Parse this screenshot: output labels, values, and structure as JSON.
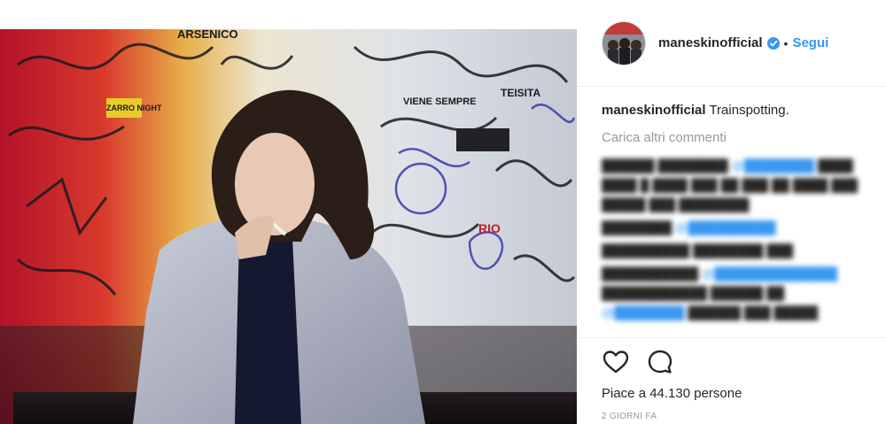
{
  "post": {
    "username": "maneskinofficial",
    "follow_label": "Segui",
    "separator": "•",
    "caption_text": "Trainspotting.",
    "load_more": "Carica altri commenti",
    "likes": "Piace a 44.130 persone",
    "time": "2 GIORNI FA"
  },
  "photo": {
    "labels": [
      "ARSENICO",
      "ZARRO NIGHT",
      "RIO",
      "VIENE SEMPRE",
      "TEISITA"
    ]
  },
  "icons": {
    "verified": "verified-badge-icon",
    "like": "heart-icon",
    "comment": "comment-icon"
  },
  "colors": {
    "link": "#3897f0",
    "text": "#262626",
    "muted": "#999999"
  }
}
